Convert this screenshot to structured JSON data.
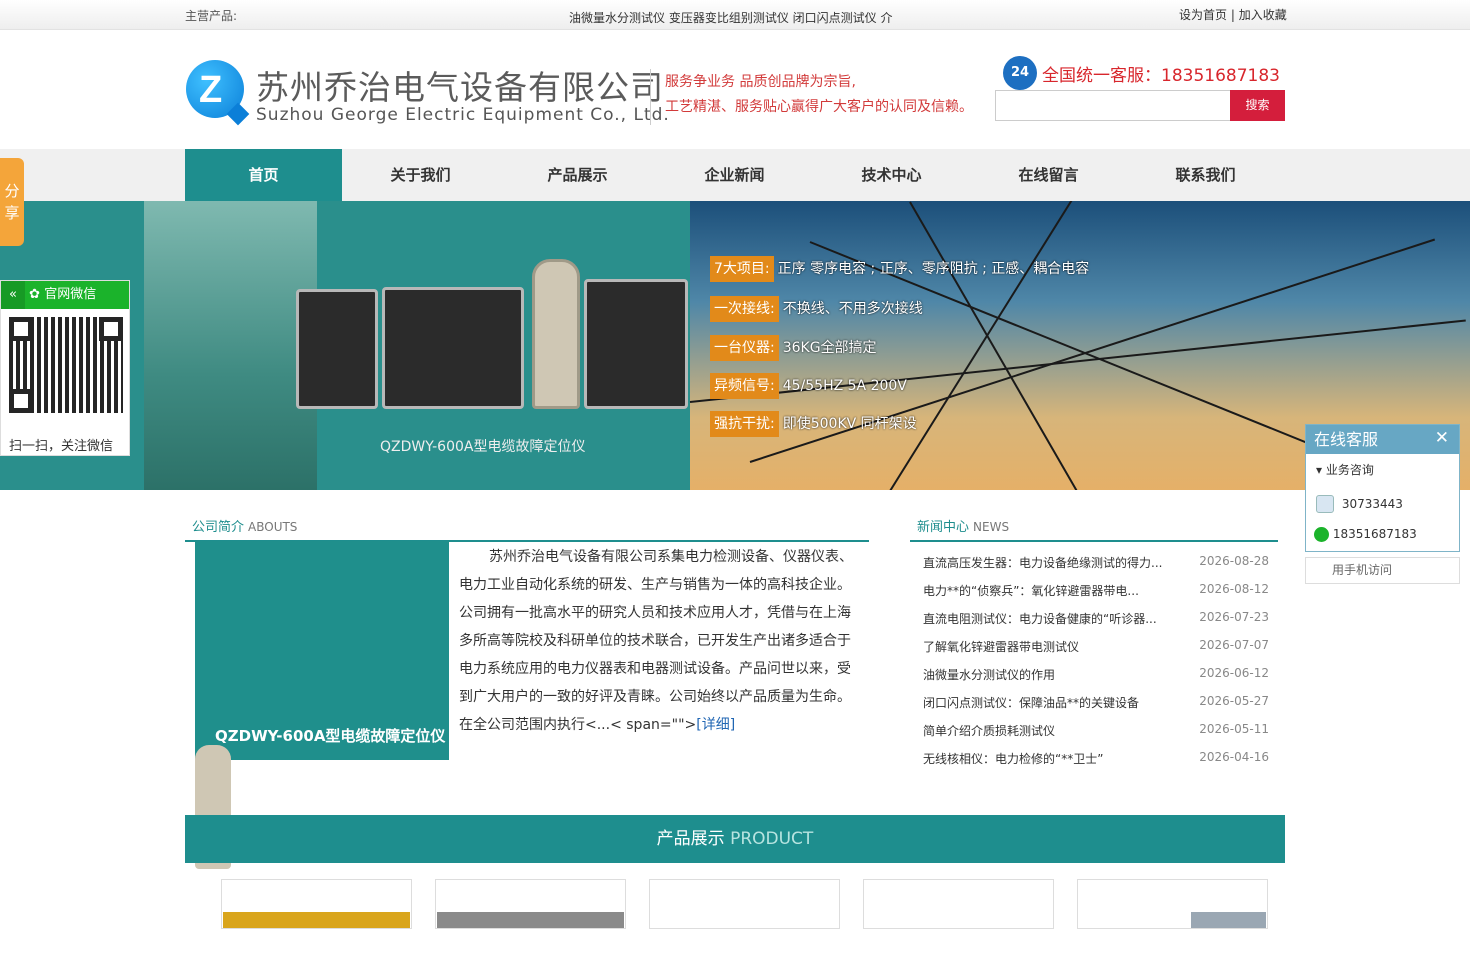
{
  "topbar": {
    "main_products_label": "主营产品:",
    "products_marquee": "油微量水分测试仪 变压器变比组别测试仪 闭口闪点测试仪 介",
    "set_home": "设为首页",
    "separator": " | ",
    "add_favorite": "加入收藏"
  },
  "header": {
    "logo_letter": "Z",
    "company_cn": "苏州乔治电气设备有限公司",
    "company_en": "Suzhou George Electric Equipment Co., Ltd.",
    "slogan_line1": "服务争业务 品质创品牌为宗旨,",
    "slogan_line2": "工艺精湛、服务贴心赢得广大客户的认同及信赖。",
    "hotline_badge": "24",
    "hotline": "全国统一客服：18351687183",
    "search_button": "搜索",
    "search_placeholder": ""
  },
  "nav": {
    "items": [
      {
        "label": "首页",
        "active": true
      },
      {
        "label": "关于我们"
      },
      {
        "label": "产品展示"
      },
      {
        "label": "企业新闻"
      },
      {
        "label": "技术中心"
      },
      {
        "label": "在线留言"
      },
      {
        "label": "联系我们"
      }
    ]
  },
  "banner": {
    "caption": "QZDWY-600A型电缆故障定位仪",
    "features": [
      {
        "tag": "7大项目:",
        "text": "正序 零序电容 ; 正序、零序阻抗 ; 正感、耦合电容"
      },
      {
        "tag": "一次接线:",
        "text": "不换线、不用多次接线"
      },
      {
        "tag": "一台仪器:",
        "text": "36KG全部搞定"
      },
      {
        "tag": "异频信号:",
        "text": "45/55HZ  5A  200V"
      },
      {
        "tag": "强抗干扰:",
        "text": "即使500KV 同杆架设"
      }
    ]
  },
  "share": {
    "label_1": "分",
    "label_2": "享"
  },
  "wechat": {
    "back_icon": "«",
    "title": "官网微信",
    "footer": "扫一扫，关注微信"
  },
  "customer_service": {
    "title": "在线客服",
    "close": "✕",
    "group": "业务咨询",
    "qq": "30733443",
    "wechat_phone": "18351687183",
    "mobile_link": "用手机访问"
  },
  "about": {
    "title": "公司简介",
    "title_en": "ABOUTS",
    "image_caption": "QZDWY-600A型电缆故障定位仪",
    "text": "苏州乔治电气设备有限公司系集电力检测设备、仪器仪表、电力工业自动化系统的研发、生产与销售为一体的高科技企业。公司拥有一批高水平的研究人员和技术应用人才，凭借与在上海多所高等院校及科研单位的技术联合，已开发生产出诸多适合于电力系统应用的电力仪器表和电器测试设备。产品问世以来，受到广大用户的一致的好评及青睐。公司始终以产品质量为生命。在全公司范围内执行<...< span=\"\">",
    "more": "[详细]"
  },
  "news": {
    "title": "新闻中心",
    "title_en": "NEWS",
    "items": [
      {
        "title": "直流高压发生器：电力设备绝缘测试的得力...",
        "date": "2026-08-28"
      },
      {
        "title": "电力**的“侦察兵”：氧化锌避雷器带电...",
        "date": "2026-08-12"
      },
      {
        "title": "直流电阻测试仪：电力设备健康的“听诊器...",
        "date": "2026-07-23"
      },
      {
        "title": "了解氧化锌避雷器带电测试仪",
        "date": "2026-07-07"
      },
      {
        "title": "油微量水分测试仪的作用",
        "date": "2026-06-12"
      },
      {
        "title": "闭口闪点测试仪：保障油品**的关键设备",
        "date": "2026-05-27"
      },
      {
        "title": "简单介绍介质损耗测试仪",
        "date": "2026-05-11"
      },
      {
        "title": "无线核相仪：电力检修的“**卫士”",
        "date": "2026-04-16"
      }
    ]
  },
  "products": {
    "title": "产品展示",
    "title_en": "PRODUCT"
  },
  "colors": {
    "brand_teal": "#1e8e8e",
    "search_red": "#d41e3c",
    "feature_orange": "#e28a1a",
    "hotline_red": "#d8262c"
  }
}
